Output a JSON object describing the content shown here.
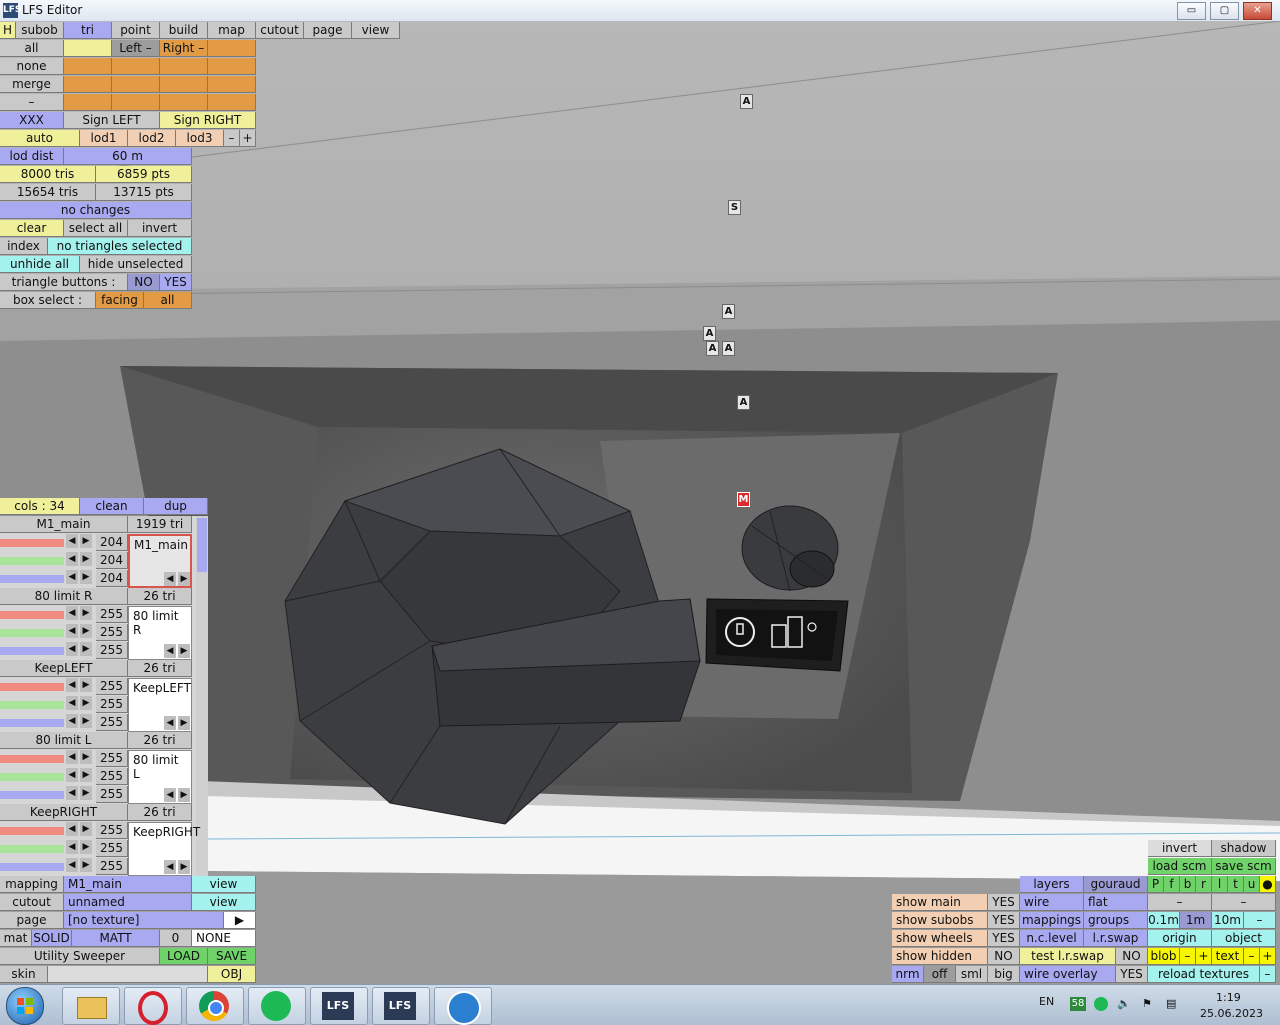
{
  "window": {
    "title": "LFS Editor",
    "icon": "lfs-logo-icon",
    "min_glyph": "▭",
    "max_glyph": "▢",
    "close_glyph": "✕"
  },
  "tabs": {
    "h": "H",
    "subob": "subob",
    "tri": "tri",
    "point": "point",
    "build": "build",
    "map": "map",
    "cutout": "cutout",
    "page": "page",
    "view": "view"
  },
  "select_panel": {
    "all": "all",
    "none": "none",
    "merge": "merge",
    "dash": "–",
    "left": "Left –",
    "right": "Right –"
  },
  "sign_row": {
    "xxx": "XXX",
    "sign_left": "Sign LEFT",
    "sign_right": "Sign RIGHT"
  },
  "lod_row": {
    "auto": "auto",
    "lod1": "lod1",
    "lod2": "lod2",
    "lod3": "lod3",
    "minus": "–",
    "plus": "+"
  },
  "lod_dist": {
    "label": "lod dist",
    "value": "60 m"
  },
  "stats": {
    "tris_limit": "8000 tris",
    "pts_limit": "6859 pts",
    "tris": "15654 tris",
    "pts": "13715 pts"
  },
  "status": "no changes",
  "selection": {
    "clear": "clear",
    "select_all": "select all",
    "invert": "invert",
    "index": "index",
    "index_info": "no triangles selected",
    "unhide_all": "unhide all",
    "hide_unselected": "hide unselected"
  },
  "triangle_buttons": {
    "label": "triangle buttons :",
    "no": "NO",
    "yes": "YES"
  },
  "box_select": {
    "label": "box select :",
    "facing": "facing",
    "all": "all"
  },
  "cols_bar": {
    "cols": "cols : 34",
    "clean": "clean",
    "dup": "dup"
  },
  "materials": [
    {
      "name": "M1_main",
      "tris": "1919 tri",
      "values": [
        "204",
        "204",
        "204"
      ],
      "preview": "M1_main"
    },
    {
      "name": "80 limit R",
      "tris": "26 tri",
      "values": [
        "255",
        "255",
        "255"
      ],
      "preview": "80 limit R"
    },
    {
      "name": "KeepLEFT",
      "tris": "26 tri",
      "values": [
        "255",
        "255",
        "255"
      ],
      "preview": "KeepLEFT"
    },
    {
      "name": "80 limit L",
      "tris": "26 tri",
      "values": [
        "255",
        "255",
        "255"
      ],
      "preview": "80 limit L"
    },
    {
      "name": "KeepRIGHT",
      "tris": "26 tri",
      "values": [
        "255",
        "255",
        "255"
      ],
      "preview": "KeepRIGHT"
    }
  ],
  "mapping": {
    "label": "mapping",
    "value": "M1_main",
    "view": "view"
  },
  "cutout": {
    "label": "cutout",
    "value": "unnamed",
    "view": "view"
  },
  "page": {
    "label": "page",
    "value": "[no texture]",
    "arrow": "▶"
  },
  "mat": {
    "label": "mat",
    "solid": "SOLID",
    "matt": "MATT",
    "zero": "0",
    "none": "NONE"
  },
  "object": {
    "name": "Utility Sweeper",
    "load": "LOAD",
    "save": "SAVE"
  },
  "skin": {
    "label": "skin",
    "obj": "OBJ"
  },
  "markers": [
    "A",
    "S",
    "A",
    "A",
    "A",
    "A",
    "A",
    "M"
  ],
  "bottom_right": {
    "invert": "invert",
    "shadow": "shadow",
    "load_scm": "load scm",
    "save_scm": "save scm",
    "layers": "layers",
    "gouraud": "gouraud",
    "flags": [
      "P",
      "f",
      "b",
      "r",
      "l",
      "t",
      "u",
      "●"
    ],
    "show_main": "show main",
    "show_main_val": "YES",
    "wire": "wire",
    "flat": "flat",
    "dash1": "–",
    "dash2": "–",
    "show_subobs": "show subobs",
    "show_subobs_val": "YES",
    "mappings": "mappings",
    "groups": "groups",
    "d01": "0.1m",
    "d1": "1m",
    "d10": "10m",
    "dminus": "–",
    "show_wheels": "show wheels",
    "show_wheels_val": "YES",
    "nc_level": "n.c.level",
    "lr_swap": "l.r.swap",
    "origin": "origin",
    "object": "object",
    "show_hidden": "show hidden",
    "show_hidden_val": "NO",
    "test_lr_swap": "test l.r.swap",
    "test_val": "NO",
    "blob": "blob",
    "text": "text",
    "minus": "–",
    "plus": "+",
    "nrm": "nrm",
    "off": "off",
    "sml": "sml",
    "big": "big",
    "wire_overlay": "wire overlay",
    "wire_overlay_val": "YES",
    "reload_textures": "reload textures",
    "end_dash": "–"
  },
  "taskbar": {
    "apps": [
      "windows-start-icon",
      "file-explorer-icon",
      "opera-icon",
      "chrome-icon",
      "spotify-icon",
      "lfs-icon",
      "lfs-editor-icon",
      "pinned-app-icon"
    ],
    "lang": "EN",
    "badge": "58",
    "time": "1:19",
    "date": "25.06.2023"
  }
}
